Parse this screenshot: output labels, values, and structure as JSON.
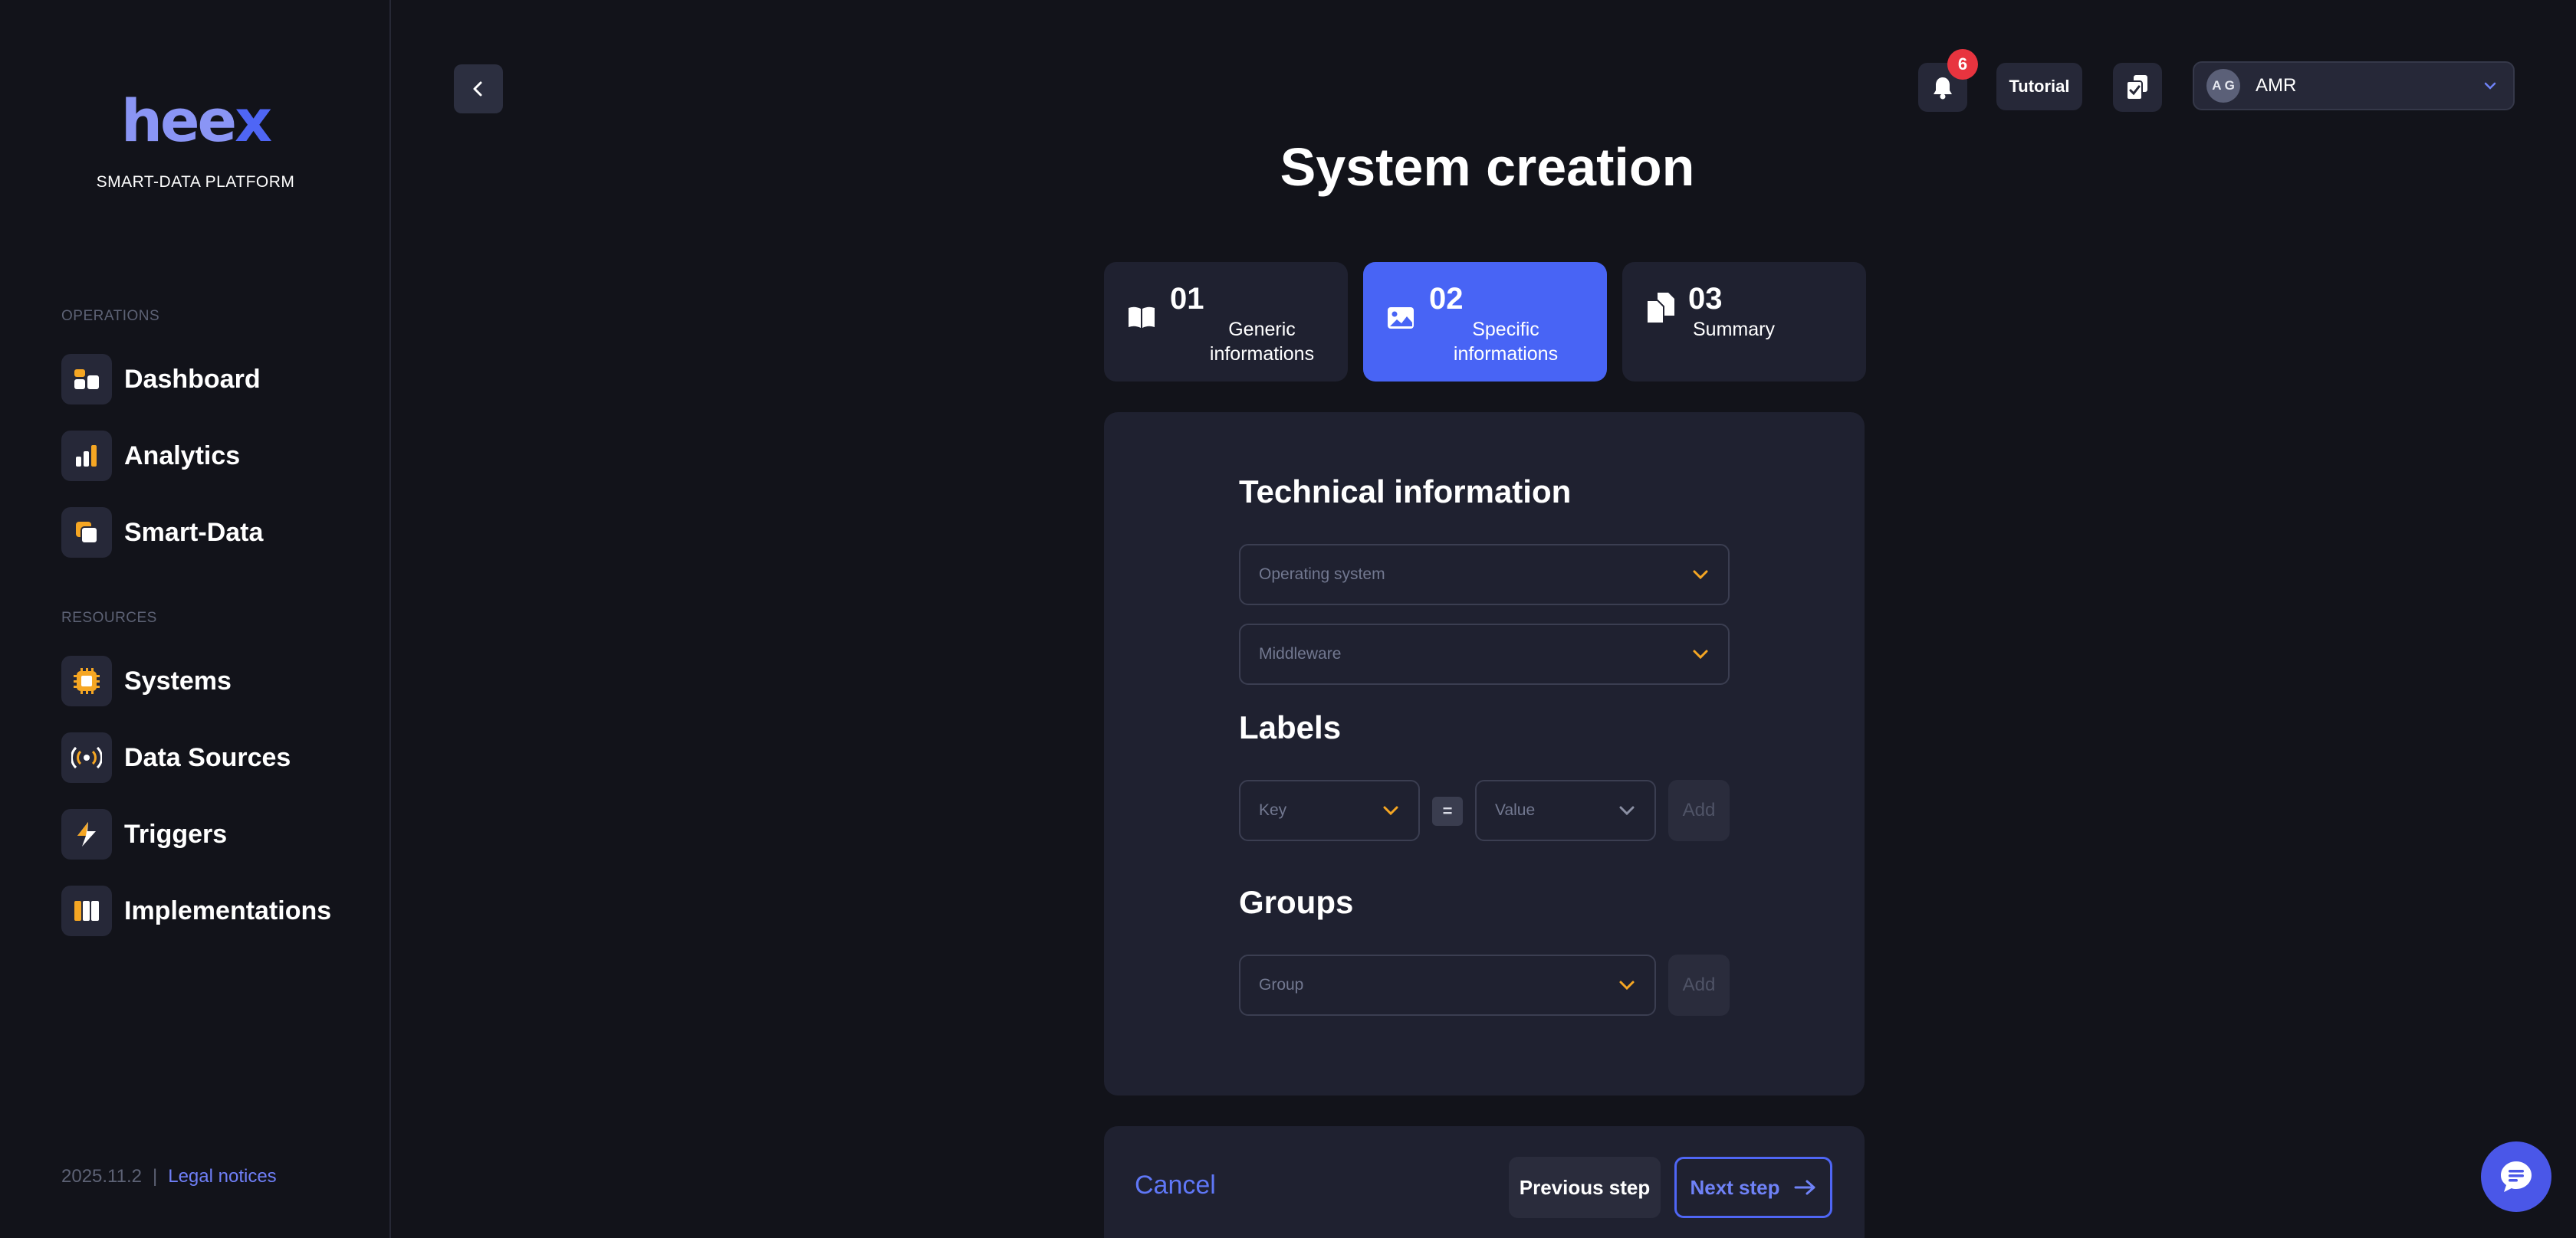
{
  "brand": {
    "logo_main": "hee",
    "logo_accent": "x",
    "tagline": "SMART-DATA PLATFORM"
  },
  "sidebar": {
    "sections": [
      {
        "title": "OPERATIONS",
        "items": [
          {
            "label": "Dashboard",
            "icon": "dashboard-icon"
          },
          {
            "label": "Analytics",
            "icon": "analytics-icon"
          },
          {
            "label": "Smart-Data",
            "icon": "smart-data-icon"
          }
        ]
      },
      {
        "title": "RESOURCES",
        "items": [
          {
            "label": "Systems",
            "icon": "chip-icon"
          },
          {
            "label": "Data Sources",
            "icon": "broadcast-icon"
          },
          {
            "label": "Triggers",
            "icon": "lightning-icon"
          },
          {
            "label": "Implementations",
            "icon": "columns-icon"
          }
        ]
      }
    ],
    "footer": {
      "version": "2025.11.2",
      "separator": "|",
      "legal": "Legal notices"
    }
  },
  "topbar": {
    "notifications_count": "6",
    "tutorial_label": "Tutorial",
    "user": {
      "initials": "A G",
      "name": "AMR"
    }
  },
  "page": {
    "title": "System creation"
  },
  "steps": [
    {
      "number": "01",
      "label": "Generic informations",
      "active": false,
      "icon": "book-icon"
    },
    {
      "number": "02",
      "label": "Specific informations",
      "active": true,
      "icon": "image-icon"
    },
    {
      "number": "03",
      "label": "Summary",
      "active": false,
      "icon": "copy-icon"
    }
  ],
  "form": {
    "technical": {
      "heading": "Technical information",
      "os_placeholder": "Operating system",
      "middleware_placeholder": "Middleware"
    },
    "labels": {
      "heading": "Labels",
      "key_placeholder": "Key",
      "equals": "=",
      "value_placeholder": "Value",
      "add_label": "Add"
    },
    "groups": {
      "heading": "Groups",
      "group_placeholder": "Group",
      "add_label": "Add"
    }
  },
  "actions": {
    "cancel": "Cancel",
    "previous": "Previous step",
    "next": "Next step"
  },
  "colors": {
    "accent": "#4864f5",
    "orange": "#f5a623",
    "background": "#12131a",
    "card": "#1f2130"
  }
}
